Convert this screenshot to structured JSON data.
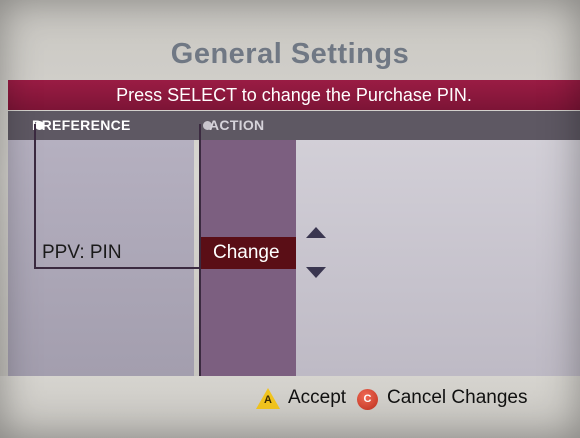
{
  "title": "General Settings",
  "instruction": "Press SELECT to change the Purchase PIN.",
  "columns": {
    "preference_header": "PREFERENCE",
    "action_header": "ACTION"
  },
  "row": {
    "preference": "PPV: PIN",
    "action": "Change"
  },
  "footer": {
    "accept_key": "A",
    "accept_label": "Accept",
    "cancel_key": "C",
    "cancel_label": "Cancel Changes"
  },
  "colors": {
    "banner": "#8a1a3d",
    "action_selected": "#5a0e16",
    "accept_button": "#f2c51e",
    "cancel_button": "#d8402b"
  }
}
